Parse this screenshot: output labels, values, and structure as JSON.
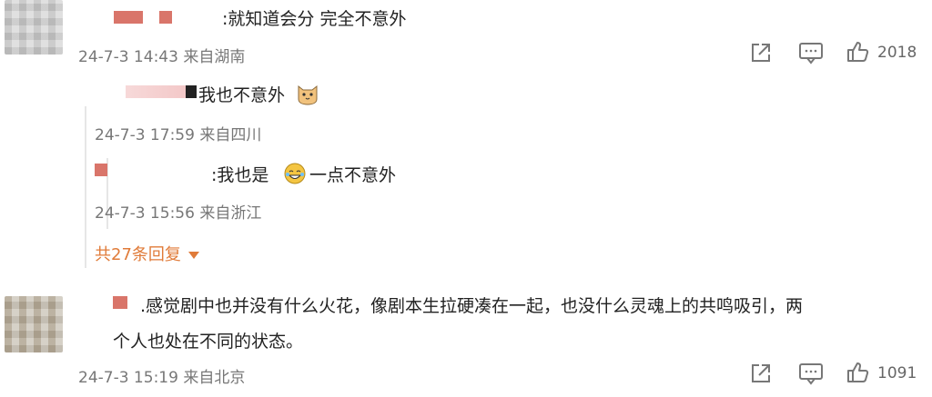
{
  "comments": [
    {
      "text": ":就知道会分 完全不意外",
      "time": "24-7-3 14:43",
      "location": "来自湖南",
      "likes": "2018",
      "replies": [
        {
          "text": "我也不意外",
          "time": "24-7-3 17:59",
          "location": "来自四川"
        },
        {
          "text": ":我也是",
          "text_after": "一点不意外",
          "time": "24-7-3 15:56",
          "location": "来自浙江"
        }
      ],
      "more_replies": "共27条回复"
    },
    {
      "text_line1": ".感觉剧中也并没有什么火花，像剧本生拉硬凑在一起，也没什么灵魂上的共鸣吸引，两",
      "text_line2": "个人也处在不同的状态。",
      "time": "24-7-3 15:19",
      "location": "来自北京",
      "likes": "1091"
    }
  ],
  "icons": {
    "share": "share-icon",
    "comment": "comment-icon",
    "like": "thumbs-up-icon",
    "emoji_cat": "cat-face-emoji-icon",
    "emoji_lol": "laughing-tears-emoji-icon",
    "dropdown": "caret-down-icon"
  },
  "colors": {
    "link": "#e07b39",
    "meta": "#777777"
  }
}
